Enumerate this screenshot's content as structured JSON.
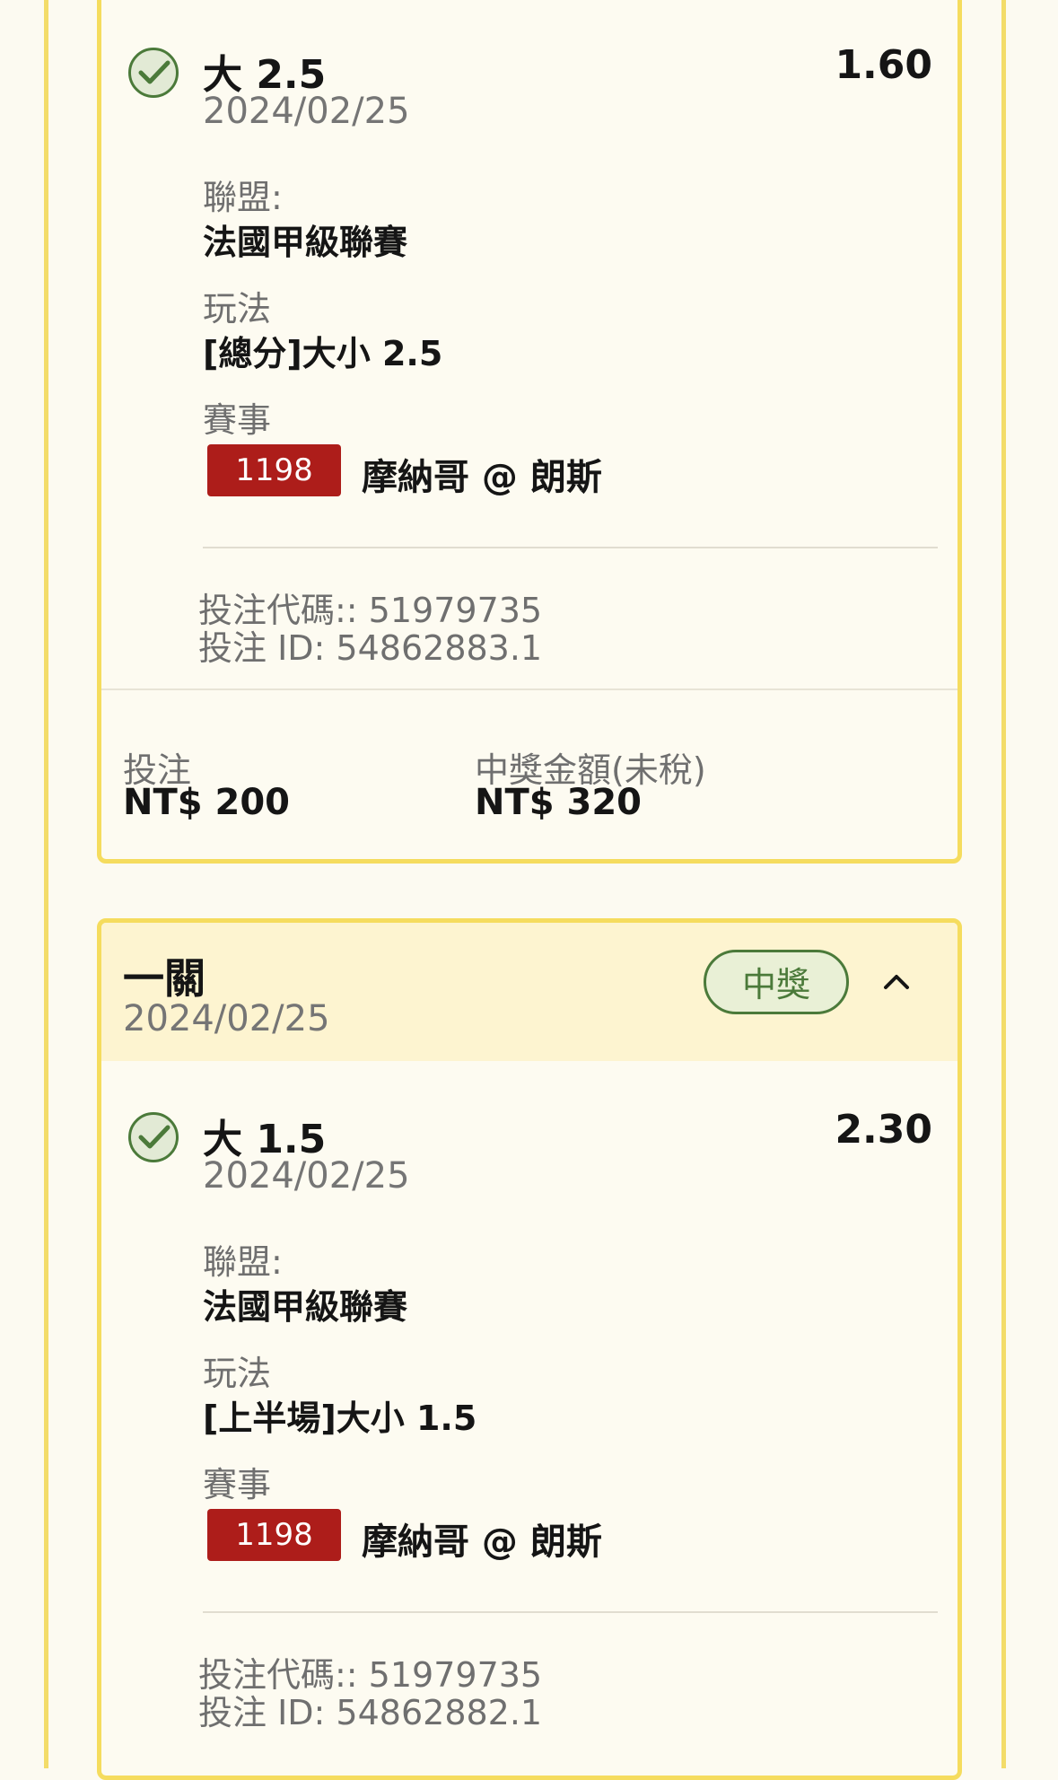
{
  "selection_top": {
    "title": "大 2.5",
    "odds": "1.60",
    "date": "2024/02/25",
    "league_label": "聯盟:",
    "league_value": "法國甲級聯賽",
    "play_label": "玩法",
    "play_value": "[總分]大小 2.5",
    "match_label": "賽事",
    "match_number": "1198",
    "match_teams": "摩納哥 @ 朗斯",
    "bet_code": "投注代碼:: 51979735",
    "bet_id": "投注 ID: 54862883.1"
  },
  "footer": {
    "stake_label": "投注",
    "stake_value": "NT$ 200",
    "payout_label": "中獎金額(未稅)",
    "payout_value": "NT$ 320"
  },
  "bet_card_2": {
    "title": "一關",
    "date": "2024/02/25",
    "status": "中獎",
    "selection": {
      "title": "大 1.5",
      "odds": "2.30",
      "date": "2024/02/25",
      "league_label": "聯盟:",
      "league_value": "法國甲級聯賽",
      "play_label": "玩法",
      "play_value": "[上半場]大小 1.5",
      "match_label": "賽事",
      "match_number": "1198",
      "match_teams": "摩納哥 @ 朗斯",
      "bet_code": "投注代碼:: 51979735",
      "bet_id": "投注 ID: 54862882.1"
    }
  },
  "icons": {
    "check": "check-circle-icon",
    "collapse": "chevron-up-icon"
  },
  "colors": {
    "card_border": "#f5dc5e",
    "header_bg": "#fdf4d0",
    "win_green": "#4b7a3a",
    "badge_red": "#ad1d1a"
  }
}
